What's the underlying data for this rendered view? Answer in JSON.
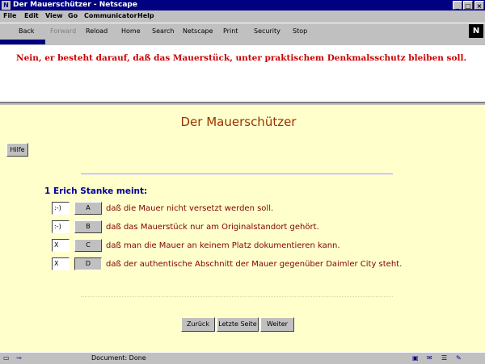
{
  "window": {
    "title": "Der Mauerschützer - Netscape"
  },
  "menu": [
    "File",
    "Edit",
    "View",
    "Go",
    "Communicator",
    "Help"
  ],
  "toolbar": {
    "back": "Back",
    "forward": "Forward",
    "reload": "Reload",
    "home": "Home",
    "search": "Search",
    "netscape": "Netscape",
    "print": "Print",
    "security": "Security",
    "stop": "Stop"
  },
  "answer_text": "Nein, er besteht darauf, daß das Mauerstück, unter praktischem Denkmalsschutz bleiben soll.",
  "page": {
    "title": "Der Mauerschützer",
    "help": "Hilfe",
    "question": "1 Erich Stanke meint:",
    "options": [
      {
        "mark": ":-)",
        "letter": "A",
        "text": "daß die Mauer nicht versetzt werden soll."
      },
      {
        "mark": ":-)",
        "letter": "B",
        "text": "daß das Mauerstück nur am Originalstandort gehört."
      },
      {
        "mark": "X",
        "letter": "C",
        "text": "daß man die Mauer an keinem Platz dokumentieren kann."
      },
      {
        "mark": "X",
        "letter": "D",
        "text": "daß der authentische Abschnitt der Mauer gegenüber Daimler City steht."
      }
    ],
    "nav": {
      "back": "Zurück",
      "last": "Letzte Seite",
      "next": "Weiter"
    }
  },
  "status": {
    "text": "Document: Done"
  }
}
